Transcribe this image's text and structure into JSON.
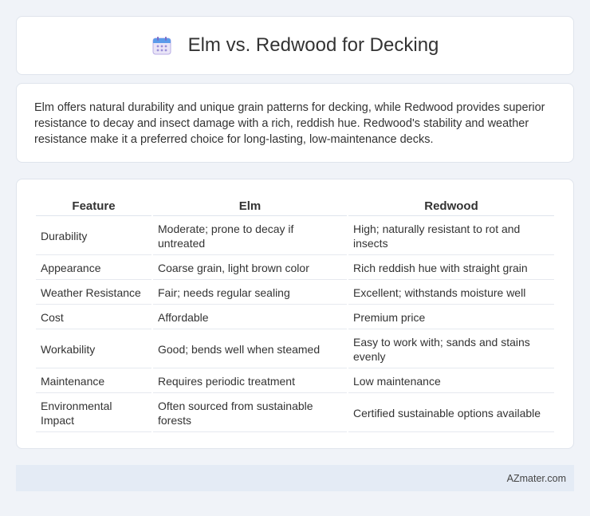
{
  "header": {
    "title": "Elm vs. Redwood for Decking",
    "icon": "calendar-icon"
  },
  "intro": {
    "text": "Elm offers natural durability and unique grain patterns for decking, while Redwood provides superior resistance to decay and insect damage with a rich, reddish hue. Redwood's stability and weather resistance make it a preferred choice for long-lasting, low-maintenance decks."
  },
  "table": {
    "headers": [
      "Feature",
      "Elm",
      "Redwood"
    ],
    "rows": [
      [
        "Durability",
        "Moderate; prone to decay if untreated",
        "High; naturally resistant to rot and insects"
      ],
      [
        "Appearance",
        "Coarse grain, light brown color",
        "Rich reddish hue with straight grain"
      ],
      [
        "Weather Resistance",
        "Fair; needs regular sealing",
        "Excellent; withstands moisture well"
      ],
      [
        "Cost",
        "Affordable",
        "Premium price"
      ],
      [
        "Workability",
        "Good; bends well when steamed",
        "Easy to work with; sands and stains evenly"
      ],
      [
        "Maintenance",
        "Requires periodic treatment",
        "Low maintenance"
      ],
      [
        "Environmental Impact",
        "Often sourced from sustainable forests",
        "Certified sustainable options available"
      ]
    ]
  },
  "footer": {
    "text": "AZmater.com"
  }
}
